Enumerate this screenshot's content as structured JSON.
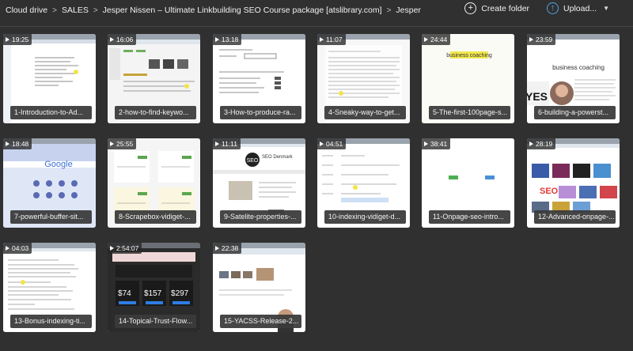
{
  "breadcrumb": [
    "Cloud drive",
    "SALES",
    "Jesper Nissen – Ultimate Linkbuilding SEO Course package [atslibrary.com]",
    "Jesper"
  ],
  "actions": {
    "create_folder": "Create folder",
    "upload": "Upload..."
  },
  "videos": [
    {
      "duration": "19:25",
      "title": "1-Introduction-to-Ad..."
    },
    {
      "duration": "16:06",
      "title": "2-how-to-find-keywo..."
    },
    {
      "duration": "13:18",
      "title": "3-How-to-produce-ra..."
    },
    {
      "duration": "11:07",
      "title": "4-Sneaky-way-to-get..."
    },
    {
      "duration": "24:44",
      "title": "5-The-first-100page-s...",
      "thumb_text": "business coaching"
    },
    {
      "duration": "23:59",
      "title": "6-building-a-powerst...",
      "thumb_text": "business coaching"
    },
    {
      "duration": "18:48",
      "title": "7-powerful-buffer-sit...",
      "thumb_text": "Google"
    },
    {
      "duration": "25:55",
      "title": "8-Scrapebox-vidiget-..."
    },
    {
      "duration": "11:11",
      "title": "9-Satelite-properties-...",
      "thumb_text": "SEO Denmark"
    },
    {
      "duration": "04:51",
      "title": "10-indexing-vidiget-d..."
    },
    {
      "duration": "38:41",
      "title": "11-Onpage-seo-intro..."
    },
    {
      "duration": "28:19",
      "title": "12-Advanced-onpage-..."
    },
    {
      "duration": "04:03",
      "title": "13-Bonus-indexing-ti..."
    },
    {
      "duration": "2:54:07",
      "title": "14-Topical-Trust-Flow...",
      "thumb_prices": [
        "74",
        "157",
        "297"
      ]
    },
    {
      "duration": "22:38",
      "title": "15-YACSS-Release-2..."
    }
  ]
}
